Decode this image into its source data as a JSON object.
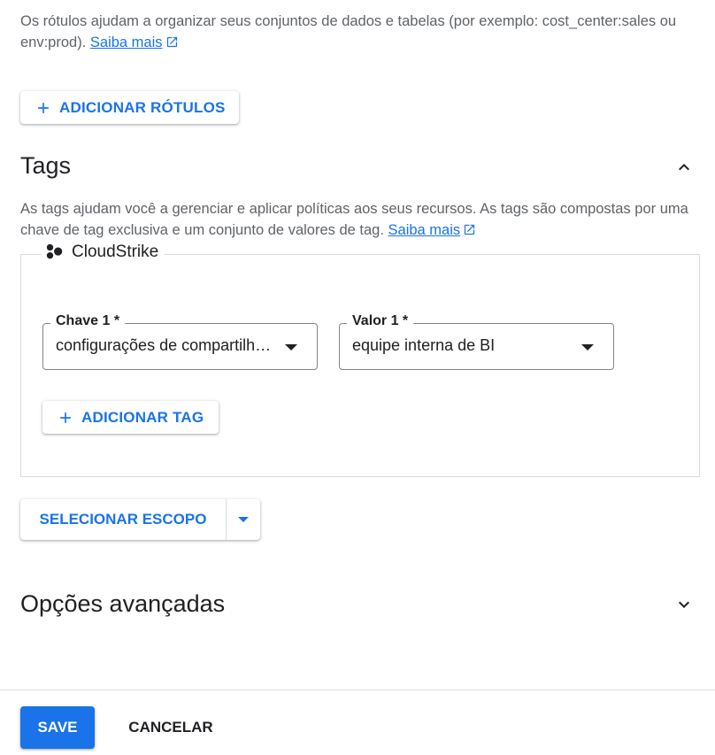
{
  "labels": {
    "description": "Os rótulos ajudam a organizar seus conjuntos de dados e tabelas (por exemplo: cost_center:sales ou env:prod).",
    "learn_more": "Saiba mais",
    "add_button": "ADICIONAR RÓTULOS"
  },
  "tags": {
    "title": "Tags",
    "description": "As tags ajudam você a gerenciar e aplicar políticas aos seus recursos. As tags são compostas por uma chave de tag exclusiva e um conjunto de valores de tag.",
    "learn_more": "Saiba mais",
    "org_name": "CloudStrike",
    "key_field": {
      "label": "Chave 1 *",
      "value": "configurações de compartilhamento"
    },
    "value_field": {
      "label": "Valor 1 *",
      "value": "equipe interna de BI"
    },
    "add_tag_button": "ADICIONAR TAG",
    "select_scope_button": "SELECIONAR ESCOPO"
  },
  "advanced": {
    "title": "Opções avançadas"
  },
  "footer": {
    "save": "SAVE",
    "cancel": "CANCELAR"
  },
  "colors": {
    "accent": "#1a73e8",
    "text": "#202124",
    "secondary_text": "#5f6368",
    "border": "#dadce0"
  }
}
